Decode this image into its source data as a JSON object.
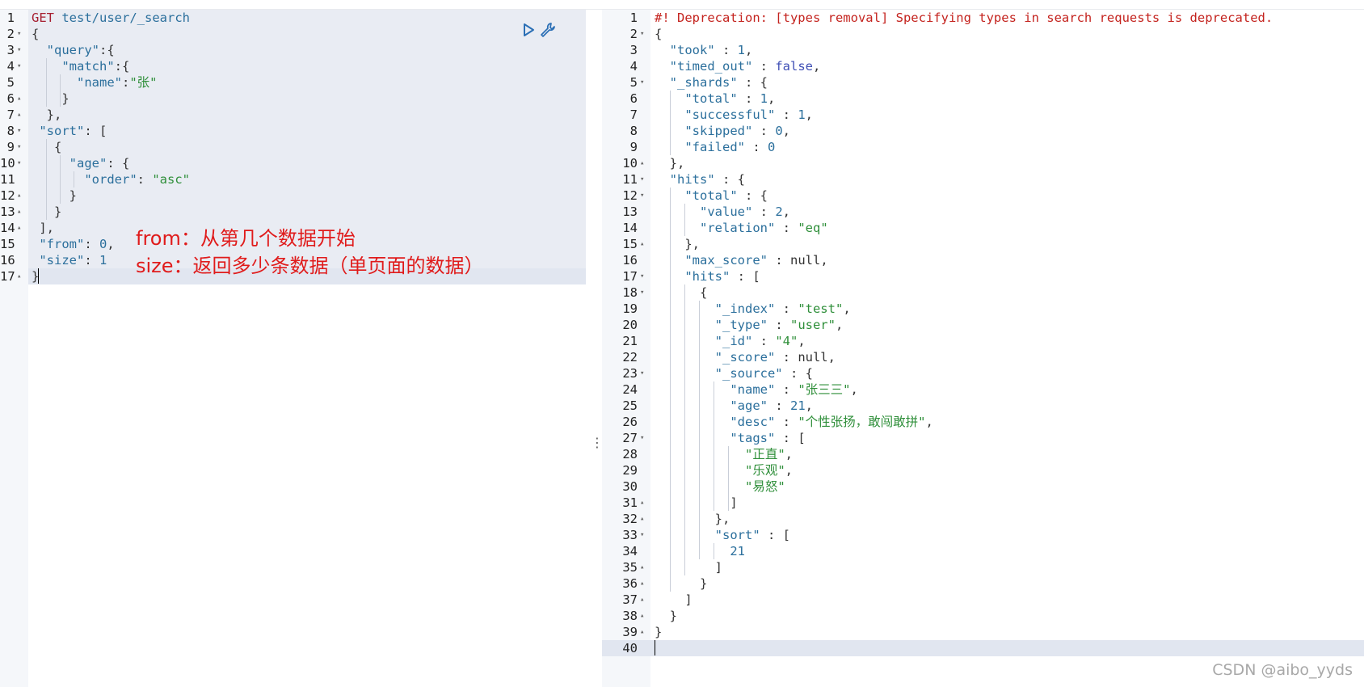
{
  "request_editor": {
    "method": "GET",
    "path": "test/user/_search",
    "lines": [
      [
        [
          "GET",
          "method"
        ],
        [
          " ",
          "pun"
        ],
        [
          "test/user/_search",
          "path"
        ]
      ],
      [
        [
          "{",
          "pun"
        ]
      ],
      [
        [
          "  ",
          "pun"
        ],
        [
          "\"query\"",
          "key"
        ],
        [
          ":{",
          "pun"
        ]
      ],
      [
        [
          "    ",
          "pun"
        ],
        [
          "\"match\"",
          "key"
        ],
        [
          ":{",
          "pun"
        ]
      ],
      [
        [
          "      ",
          "pun"
        ],
        [
          "\"name\"",
          "key"
        ],
        [
          ":",
          "pun"
        ],
        [
          "\"张\"",
          "str"
        ]
      ],
      [
        [
          "    }",
          "pun"
        ]
      ],
      [
        [
          "  },",
          "pun"
        ]
      ],
      [
        [
          " ",
          "pun"
        ],
        [
          "\"sort\"",
          "key"
        ],
        [
          ": [",
          "pun"
        ]
      ],
      [
        [
          "   {",
          "pun"
        ]
      ],
      [
        [
          "     ",
          "pun"
        ],
        [
          "\"age\"",
          "key"
        ],
        [
          ": {",
          "pun"
        ]
      ],
      [
        [
          "       ",
          "pun"
        ],
        [
          "\"order\"",
          "key"
        ],
        [
          ": ",
          "pun"
        ],
        [
          "\"asc\"",
          "str"
        ]
      ],
      [
        [
          "     }",
          "pun"
        ]
      ],
      [
        [
          "   }",
          "pun"
        ]
      ],
      [
        [
          " ],",
          "pun"
        ]
      ],
      [
        [
          " ",
          "pun"
        ],
        [
          "\"from\"",
          "key"
        ],
        [
          ": ",
          "pun"
        ],
        [
          "0",
          "num"
        ],
        [
          ",",
          "pun"
        ]
      ],
      [
        [
          " ",
          "pun"
        ],
        [
          "\"size\"",
          "key"
        ],
        [
          ": ",
          "pun"
        ],
        [
          "1",
          "num"
        ]
      ],
      [
        [
          "}",
          "pun"
        ]
      ]
    ],
    "folds": [
      "",
      "v",
      "v",
      "v",
      "",
      "^",
      "^",
      "v",
      "v",
      "v",
      "",
      "^",
      "^",
      "^",
      "",
      "",
      "^"
    ]
  },
  "annotation": {
    "line1": "from：从第几个数据开始",
    "line2": "size：返回多少条数据（单页面的数据）"
  },
  "response_viewer": {
    "lines": [
      [
        [
          "#! Deprecation: [types removal] Specifying types in search requests is deprecated.",
          "warn"
        ]
      ],
      [
        [
          "{",
          "pun"
        ]
      ],
      [
        [
          "  ",
          "pun"
        ],
        [
          "\"took\"",
          "key"
        ],
        [
          " : ",
          "pun"
        ],
        [
          "1",
          "num"
        ],
        [
          ",",
          "pun"
        ]
      ],
      [
        [
          "  ",
          "pun"
        ],
        [
          "\"timed_out\"",
          "key"
        ],
        [
          " : ",
          "pun"
        ],
        [
          "false",
          "bool"
        ],
        [
          ",",
          "pun"
        ]
      ],
      [
        [
          "  ",
          "pun"
        ],
        [
          "\"_shards\"",
          "key"
        ],
        [
          " : {",
          "pun"
        ]
      ],
      [
        [
          "    ",
          "pun"
        ],
        [
          "\"total\"",
          "key"
        ],
        [
          " : ",
          "pun"
        ],
        [
          "1",
          "num"
        ],
        [
          ",",
          "pun"
        ]
      ],
      [
        [
          "    ",
          "pun"
        ],
        [
          "\"successful\"",
          "key"
        ],
        [
          " : ",
          "pun"
        ],
        [
          "1",
          "num"
        ],
        [
          ",",
          "pun"
        ]
      ],
      [
        [
          "    ",
          "pun"
        ],
        [
          "\"skipped\"",
          "key"
        ],
        [
          " : ",
          "pun"
        ],
        [
          "0",
          "num"
        ],
        [
          ",",
          "pun"
        ]
      ],
      [
        [
          "    ",
          "pun"
        ],
        [
          "\"failed\"",
          "key"
        ],
        [
          " : ",
          "pun"
        ],
        [
          "0",
          "num"
        ]
      ],
      [
        [
          "  },",
          "pun"
        ]
      ],
      [
        [
          "  ",
          "pun"
        ],
        [
          "\"hits\"",
          "key"
        ],
        [
          " : {",
          "pun"
        ]
      ],
      [
        [
          "    ",
          "pun"
        ],
        [
          "\"total\"",
          "key"
        ],
        [
          " : {",
          "pun"
        ]
      ],
      [
        [
          "      ",
          "pun"
        ],
        [
          "\"value\"",
          "key"
        ],
        [
          " : ",
          "pun"
        ],
        [
          "2",
          "num"
        ],
        [
          ",",
          "pun"
        ]
      ],
      [
        [
          "      ",
          "pun"
        ],
        [
          "\"relation\"",
          "key"
        ],
        [
          " : ",
          "pun"
        ],
        [
          "\"eq\"",
          "str"
        ]
      ],
      [
        [
          "    },",
          "pun"
        ]
      ],
      [
        [
          "    ",
          "pun"
        ],
        [
          "\"max_score\"",
          "key"
        ],
        [
          " : ",
          "pun"
        ],
        [
          "null",
          "null"
        ],
        [
          ",",
          "pun"
        ]
      ],
      [
        [
          "    ",
          "pun"
        ],
        [
          "\"hits\"",
          "key"
        ],
        [
          " : [",
          "pun"
        ]
      ],
      [
        [
          "      {",
          "pun"
        ]
      ],
      [
        [
          "        ",
          "pun"
        ],
        [
          "\"_index\"",
          "key"
        ],
        [
          " : ",
          "pun"
        ],
        [
          "\"test\"",
          "str"
        ],
        [
          ",",
          "pun"
        ]
      ],
      [
        [
          "        ",
          "pun"
        ],
        [
          "\"_type\"",
          "key"
        ],
        [
          " : ",
          "pun"
        ],
        [
          "\"user\"",
          "str"
        ],
        [
          ",",
          "pun"
        ]
      ],
      [
        [
          "        ",
          "pun"
        ],
        [
          "\"_id\"",
          "key"
        ],
        [
          " : ",
          "pun"
        ],
        [
          "\"4\"",
          "str"
        ],
        [
          ",",
          "pun"
        ]
      ],
      [
        [
          "        ",
          "pun"
        ],
        [
          "\"_score\"",
          "key"
        ],
        [
          " : ",
          "pun"
        ],
        [
          "null",
          "null"
        ],
        [
          ",",
          "pun"
        ]
      ],
      [
        [
          "        ",
          "pun"
        ],
        [
          "\"_source\"",
          "key"
        ],
        [
          " : {",
          "pun"
        ]
      ],
      [
        [
          "          ",
          "pun"
        ],
        [
          "\"name\"",
          "key"
        ],
        [
          " : ",
          "pun"
        ],
        [
          "\"张三三\"",
          "str"
        ],
        [
          ",",
          "pun"
        ]
      ],
      [
        [
          "          ",
          "pun"
        ],
        [
          "\"age\"",
          "key"
        ],
        [
          " : ",
          "pun"
        ],
        [
          "21",
          "num"
        ],
        [
          ",",
          "pun"
        ]
      ],
      [
        [
          "          ",
          "pun"
        ],
        [
          "\"desc\"",
          "key"
        ],
        [
          " : ",
          "pun"
        ],
        [
          "\"个性张扬，敢闯敢拼\"",
          "str"
        ],
        [
          ",",
          "pun"
        ]
      ],
      [
        [
          "          ",
          "pun"
        ],
        [
          "\"tags\"",
          "key"
        ],
        [
          " : [",
          "pun"
        ]
      ],
      [
        [
          "            ",
          "pun"
        ],
        [
          "\"正直\"",
          "str"
        ],
        [
          ",",
          "pun"
        ]
      ],
      [
        [
          "            ",
          "pun"
        ],
        [
          "\"乐观\"",
          "str"
        ],
        [
          ",",
          "pun"
        ]
      ],
      [
        [
          "            ",
          "pun"
        ],
        [
          "\"易怒\"",
          "str"
        ]
      ],
      [
        [
          "          ]",
          "pun"
        ]
      ],
      [
        [
          "        },",
          "pun"
        ]
      ],
      [
        [
          "        ",
          "pun"
        ],
        [
          "\"sort\"",
          "key"
        ],
        [
          " : [",
          "pun"
        ]
      ],
      [
        [
          "          ",
          "pun"
        ],
        [
          "21",
          "num"
        ]
      ],
      [
        [
          "        ]",
          "pun"
        ]
      ],
      [
        [
          "      }",
          "pun"
        ]
      ],
      [
        [
          "    ]",
          "pun"
        ]
      ],
      [
        [
          "  }",
          "pun"
        ]
      ],
      [
        [
          "}",
          "pun"
        ]
      ],
      [
        [
          "",
          "pun"
        ]
      ]
    ],
    "folds": [
      "",
      "v",
      "",
      "",
      "v",
      "",
      "",
      "",
      "",
      "^",
      "v",
      "v",
      "",
      "",
      "^",
      "",
      "v",
      "v",
      "",
      "",
      "",
      "",
      "v",
      "",
      "",
      "",
      "v",
      "",
      "",
      "",
      "^",
      "^",
      "v",
      "",
      "^",
      "^",
      "^",
      "^",
      "^",
      ""
    ]
  },
  "toolbar": {
    "run_icon": "play-icon",
    "settings_icon": "wrench-icon"
  },
  "watermark": "CSDN @aibo_yyds",
  "colors": {
    "key": "#2b6f9c",
    "string": "#2f8f3a",
    "warning": "#c4231e",
    "annotation": "#e01b1b"
  }
}
